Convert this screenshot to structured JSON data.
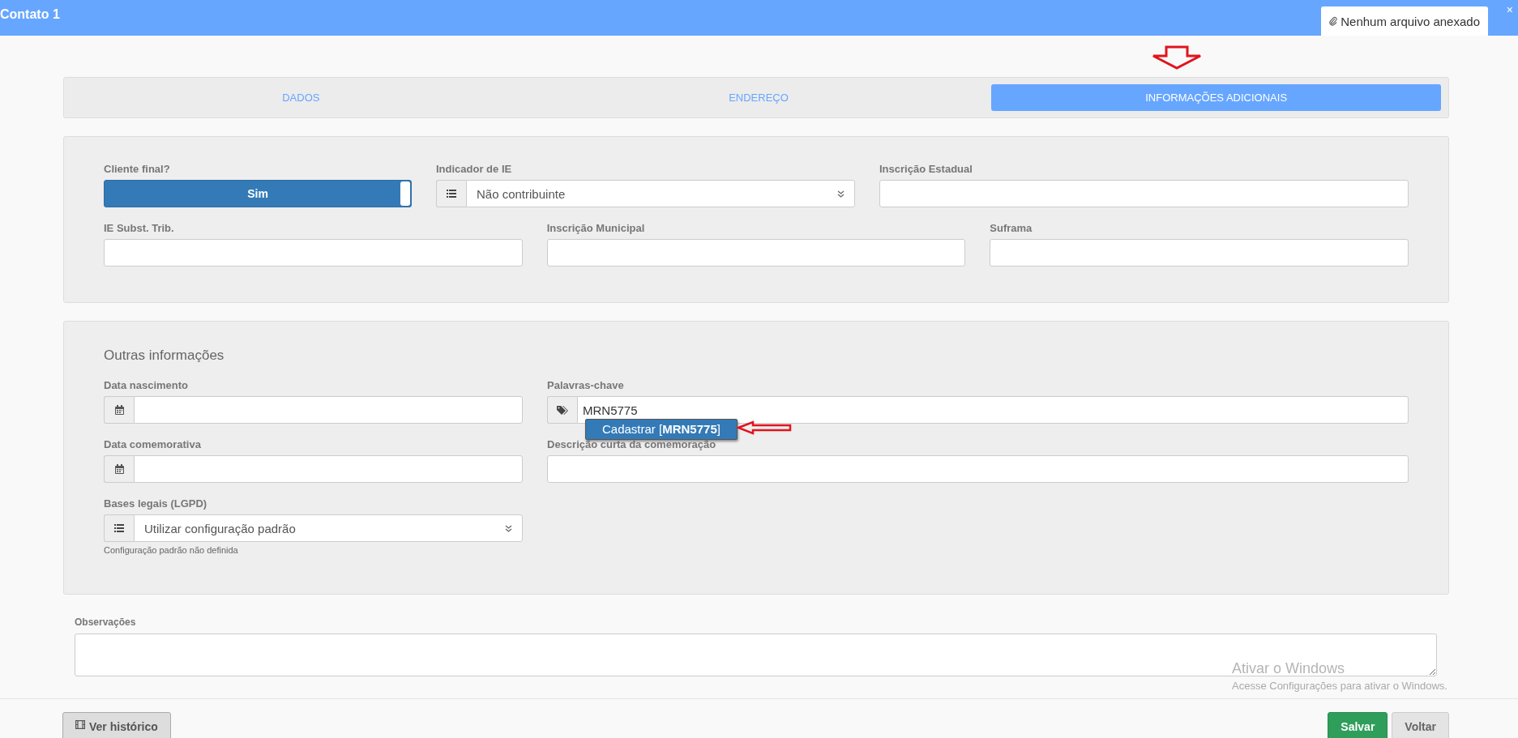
{
  "window": {
    "title": "Contato 1",
    "attachment": "Nenhum arquivo anexado",
    "close": "×"
  },
  "tabs": [
    {
      "label": "DADOS",
      "selected": false
    },
    {
      "label": "ENDEREÇO",
      "selected": false
    },
    {
      "label": "INFORMAÇÕES ADICIONAIS",
      "selected": true
    }
  ],
  "panel_1": {
    "rows": [
      [
        {
          "kind": "toggle",
          "label": "Cliente final?",
          "value": "Sim",
          "on": true
        },
        {
          "kind": "select",
          "label": "Indicador de IE",
          "value": "Não contribuinte"
        },
        {
          "kind": "text",
          "label": "Inscrição Estadual"
        }
      ],
      [
        {
          "kind": "text",
          "label": "IE Subst. Trib."
        },
        {
          "kind": "text",
          "label": "Inscrição Municipal"
        },
        {
          "kind": "text",
          "label": "Suframa"
        }
      ]
    ]
  },
  "panel_2": {
    "heading": "Outras informações",
    "rows": [
      [
        {
          "kind": "date",
          "label": "Data nascimento"
        },
        {
          "kind": "tags",
          "label": "Palavras-chave",
          "value": "MRN5775",
          "suggestion": "Cadastrar [**MRN5775**]"
        }
      ],
      [
        {
          "kind": "date",
          "label": "Data comemorativa"
        },
        {
          "kind": "text",
          "label": "Descrição curta da comemoração"
        }
      ],
      [
        {
          "kind": "select",
          "label": "Bases legais (LGPD)",
          "value": "Utilizar configuração padrão",
          "help": "Configuração padrão não definida"
        }
      ]
    ]
  },
  "notes": {
    "label": "Observações"
  },
  "footer": {
    "history_button": "Ver histórico",
    "save_button": "Salvar",
    "back_button": "Voltar"
  },
  "os_notice": {
    "title": "Ativar o Windows",
    "text": "Acesse Configurações para ativar o Windows."
  }
}
